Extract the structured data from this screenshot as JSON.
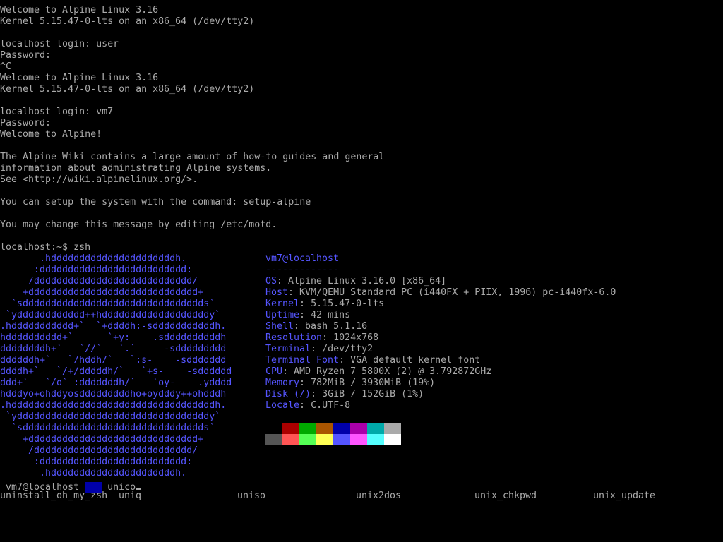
{
  "boot": [
    "Welcome to Alpine Linux 3.16",
    "Kernel 5.15.47-0-lts on an x86_64 (/dev/tty2)",
    "",
    "localhost login: user",
    "Password:",
    "^C",
    "Welcome to Alpine Linux 3.16",
    "Kernel 5.15.47-0-lts on an x86_64 (/dev/tty2)",
    "",
    "localhost login: vm7",
    "Password:",
    "Welcome to Alpine!",
    "",
    "The Alpine Wiki contains a large amount of how-to guides and general",
    "information about administrating Alpine systems.",
    "See <http://wiki.alpinelinux.org/>.",
    "",
    "You can setup the system with the command: setup-alpine",
    "",
    "You may change this message by editing /etc/motd.",
    "",
    "localhost:~$ zsh"
  ],
  "ascii_art": [
    "       .hddddddddddddddddddddddh.",
    "      :dddddddddddddddddddddddddd:",
    "     /dddddddddddddddddddddddddddd/",
    "    +dddddddddddddddddddddddddddddd+",
    "  `sdddddddddddddddddddddddddddddddds`",
    " `ydddddddddddd++hdddddddddddddddddddy`",
    ".hddddddddddd+`  `+ddddh:-sdddddddddddh.",
    "hdddddddddd+`      `+y:    .sddddddddddh",
    "ddddddddh+`   `//`   `.`     -sddddddddd",
    "ddddddh+`   `/hddh/`   `:s-    -sddddddd",
    "ddddh+`   `/+/dddddh/`   `+s-    -sdddddd",
    "ddd+`   `/o` :dddddddh/`   `oy-    .ydddd",
    "hdddyo+ohddyosdddddddddho+oydddy++ohdddh",
    ".hddddddddddddddddddddddddddddddddddddh.",
    " `yddddddddddddddddddddddddddddddddddy`",
    "  `sdddddddddddddddddddddddddddddddds`",
    "    +dddddddddddddddddddddddddddddd+",
    "     /dddddddddddddddddddddddddddd/",
    "      :dddddddddddddddddddddddddd:",
    "       .hddddddddddddddddddddddh."
  ],
  "sysinfo": {
    "user_host": "vm7@localhost",
    "separator": "-------------",
    "rows": [
      {
        "key": "OS",
        "value": "Alpine Linux 3.16.0 [x86_64]"
      },
      {
        "key": "Host",
        "value": "KVM/QEMU Standard PC (i440FX + PIIX, 1996) pc-i440fx-6.0"
      },
      {
        "key": "Kernel",
        "value": "5.15.47-0-lts"
      },
      {
        "key": "Uptime",
        "value": "42 mins"
      },
      {
        "key": "Shell",
        "value": "bash 5.1.16"
      },
      {
        "key": "Resolution",
        "value": "1024x768"
      },
      {
        "key": "Terminal",
        "value": "/dev/tty2"
      },
      {
        "key": "Terminal Font",
        "value": "VGA default kernel font"
      },
      {
        "key": "CPU",
        "value": "AMD Ryzen 7 5800X (2) @ 3.792872GHz"
      },
      {
        "key": "Memory",
        "value": "782MiB / 3930MiB (19%)"
      },
      {
        "key": "Disk (/)",
        "value": "3GiB / 152GiB (1%)"
      },
      {
        "key": "Locale",
        "value": "C.UTF-8"
      }
    ]
  },
  "palette": {
    "row1": [
      "#000000",
      "#aa0000",
      "#00aa00",
      "#aa5500",
      "#0000aa",
      "#aa00aa",
      "#00aaaa",
      "#aaaaaa"
    ],
    "row2": [
      "#555555",
      "#ff5555",
      "#55ff55",
      "#ffff55",
      "#5555ff",
      "#ff55ff",
      "#55ffff",
      "#ffffff"
    ]
  },
  "prompt": {
    "user_host": "vm7@localhost",
    "path": "~",
    "input": "unico"
  },
  "completions": [
    "uninstall_oh_my_zsh",
    "uniq",
    "uniso",
    "unix2dos",
    "unix_chkpwd",
    "unix_update"
  ]
}
